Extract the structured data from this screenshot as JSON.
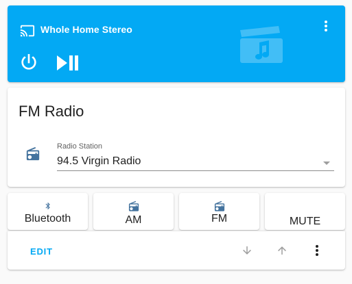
{
  "media_player": {
    "title": "Whole Home Stereo",
    "icons": [
      "cast-icon",
      "dots-vertical-icon",
      "video-music-icon",
      "power-icon",
      "play-pause-icon"
    ]
  },
  "fm_card": {
    "title": "FM Radio",
    "select_label": "Radio Station",
    "select_value": "94.5 Virgin Radio"
  },
  "buttons": [
    {
      "label": "Bluetooth",
      "icon": "bluetooth-icon"
    },
    {
      "label": "AM",
      "icon": "radio-icon"
    },
    {
      "label": "FM",
      "icon": "radio-icon"
    },
    {
      "label": "MUTE"
    }
  ],
  "footer": {
    "edit_label": "EDIT",
    "icons": [
      "arrow-down-icon",
      "arrow-up-icon",
      "dots-vertical-icon"
    ]
  },
  "colors": {
    "accent": "#03a9f4",
    "icon": "#44739e"
  }
}
